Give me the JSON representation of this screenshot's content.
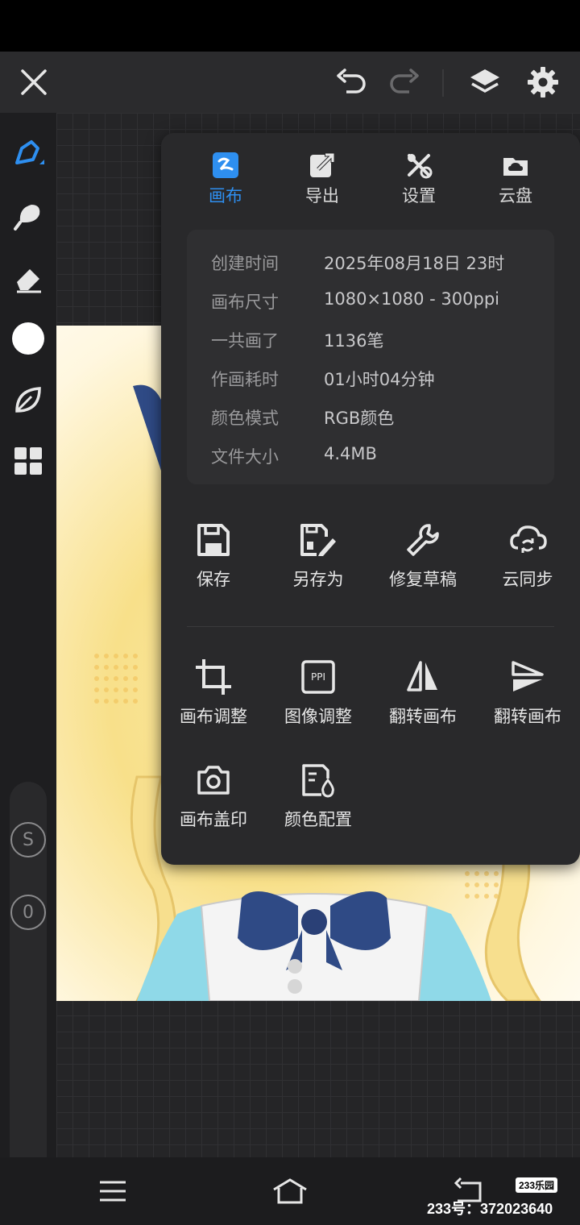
{
  "colors": {
    "accent": "#2e8ff0",
    "panel_bg": "#29292b",
    "toolbar_bg": "#2b2b2d"
  },
  "toolbar": {
    "close_icon": "close-icon",
    "undo_icon": "undo-icon",
    "redo_icon": "redo-icon",
    "layers_icon": "layers-icon",
    "settings_icon": "gear-icon"
  },
  "left_rail": {
    "tools": [
      "brush-icon",
      "smudge-icon",
      "eraser-icon",
      "color-swatch",
      "leaf-icon",
      "grid-icon"
    ],
    "badge_size": "S",
    "badge_opacity": "0"
  },
  "panel": {
    "tabs": [
      {
        "label": "画布",
        "icon": "canvas-icon",
        "active": true
      },
      {
        "label": "导出",
        "icon": "export-icon",
        "active": false
      },
      {
        "label": "设置",
        "icon": "tools-icon",
        "active": false
      },
      {
        "label": "云盘",
        "icon": "cloud-drive-icon",
        "active": false
      }
    ],
    "info": [
      {
        "key": "创建时间",
        "value": "2025年08月18日 23时"
      },
      {
        "key": "画布尺寸",
        "value": "1080×1080 - 300ppi"
      },
      {
        "key": "一共画了",
        "value": "1136笔"
      },
      {
        "key": "作画耗时",
        "value": "01小时04分钟"
      },
      {
        "key": "颜色模式",
        "value": "RGB颜色"
      },
      {
        "key": "文件大小",
        "value": "4.4MB"
      }
    ],
    "actions_row1": [
      {
        "label": "保存",
        "icon": "save-icon"
      },
      {
        "label": "另存为",
        "icon": "save-as-icon"
      },
      {
        "label": "修复草稿",
        "icon": "wrench-icon"
      },
      {
        "label": "云同步",
        "icon": "cloud-sync-icon"
      }
    ],
    "actions_row2": [
      {
        "label": "画布调整",
        "icon": "crop-icon"
      },
      {
        "label": "图像调整",
        "icon": "ppi-icon",
        "icon_text": "PPI"
      },
      {
        "label": "翻转画布",
        "icon": "flip-horizontal-icon"
      },
      {
        "label": "翻转画布",
        "icon": "flip-vertical-icon"
      }
    ],
    "actions_row3": [
      {
        "label": "画布盖印",
        "icon": "camera-icon"
      },
      {
        "label": "颜色配置",
        "icon": "color-profile-icon"
      }
    ]
  },
  "navbar": {
    "menu_icon": "menu-icon",
    "home_icon": "home-icon",
    "back_icon": "back-icon"
  },
  "watermark": {
    "badge": "233乐园",
    "text": "233号：372023640"
  }
}
